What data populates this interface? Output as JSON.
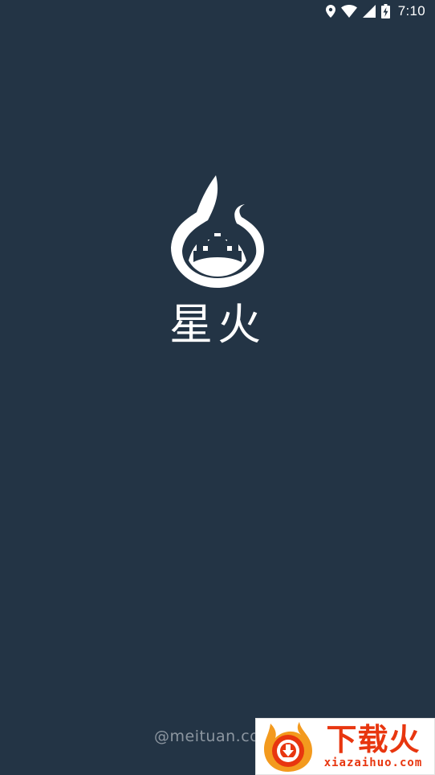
{
  "status_bar": {
    "time": "7:10",
    "icons": [
      "location-icon",
      "wifi-icon",
      "signal-icon",
      "battery-charging-icon"
    ]
  },
  "splash": {
    "logo_icon": "flame-castle-logo",
    "app_name": "星火",
    "footer": "@meituan.com"
  },
  "watermark": {
    "logo_icon": "xiazaihuo-flame-logo",
    "title": "下载火",
    "url": "xiazaihuo.com"
  },
  "colors": {
    "background": "#233445",
    "foreground": "#ffffff",
    "footer_text": "#8c96a0",
    "watermark_accent": "#e8360f"
  }
}
